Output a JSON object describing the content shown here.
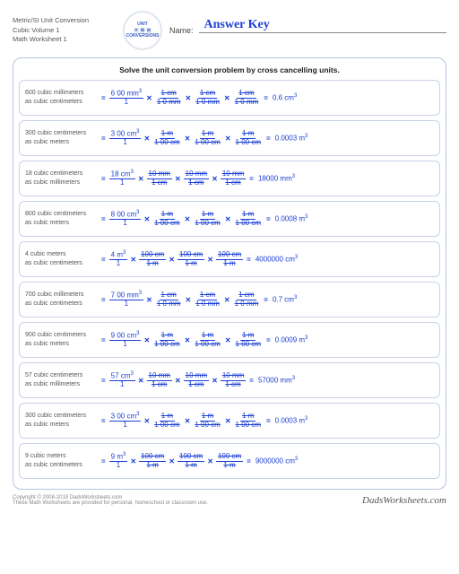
{
  "header": {
    "line1": "Metric/SI Unit Conversion",
    "line2": "Cubic Volume 1",
    "line3": "Math Worksheet 1",
    "logo_top": "UNIT",
    "logo_bot": "CONVERSIONS",
    "name_label": "Name:",
    "answer": "Answer Key"
  },
  "instruction": "Solve the unit conversion problem by cross cancelling units.",
  "rows": [
    {
      "q1": "600 cubic millimeters",
      "q2": "as cubic centimeters",
      "n0": "6 00 mm",
      "d0": "1",
      "nf": "1 cm",
      "df": "1 0 mm",
      "r": "0.6 cm",
      "e": "3"
    },
    {
      "q1": "300 cubic centimeters",
      "q2": "as cubic meters",
      "n0": "3 00 cm",
      "d0": "1",
      "nf": "1 m",
      "df": "1 00 cm",
      "r": "0.0003 m",
      "e": "3"
    },
    {
      "q1": "18 cubic centimeters",
      "q2": "as cubic millimeters",
      "n0": "18 cm",
      "d0": "1",
      "nf": "10 mm",
      "df": "1 cm",
      "r": "18000 mm",
      "e": "3"
    },
    {
      "q1": "800 cubic centimeters",
      "q2": "as cubic meters",
      "n0": "8 00 cm",
      "d0": "1",
      "nf": "1 m",
      "df": "1 00 cm",
      "r": "0.0008 m",
      "e": "3"
    },
    {
      "q1": "4 cubic meters",
      "q2": "as cubic centimeters",
      "n0": "4 m",
      "d0": "1",
      "nf": "100 cm",
      "df": "1 m",
      "r": "4000000 cm",
      "e": "3"
    },
    {
      "q1": "700 cubic millimeters",
      "q2": "as cubic centimeters",
      "n0": "7 00 mm",
      "d0": "1",
      "nf": "1 cm",
      "df": "1 0 mm",
      "r": "0.7 cm",
      "e": "3"
    },
    {
      "q1": "900 cubic centimeters",
      "q2": "as cubic meters",
      "n0": "9 00 cm",
      "d0": "1",
      "nf": "1 m",
      "df": "1 00 cm",
      "r": "0.0009 m",
      "e": "3"
    },
    {
      "q1": "57 cubic centimeters",
      "q2": "as cubic millimeters",
      "n0": "57 cm",
      "d0": "1",
      "nf": "10 mm",
      "df": "1 cm",
      "r": "57000 mm",
      "e": "3"
    },
    {
      "q1": "300 cubic centimeters",
      "q2": "as cubic meters",
      "n0": "3 00 cm",
      "d0": "1",
      "nf": "1 m",
      "df": "1 00 cm",
      "r": "0.0003 m",
      "e": "3"
    },
    {
      "q1": "9 cubic meters",
      "q2": "as cubic centimeters",
      "n0": "9 m",
      "d0": "1",
      "nf": "100 cm",
      "df": "1 m",
      "r": "9000000 cm",
      "e": "3"
    }
  ],
  "footer": {
    "copy": "Copyright © 2008-2019 DadsWorksheets.com",
    "note": "These Math Worksheets are provided for personal, homeschool or classroom use.",
    "brand": "DadsWorksheets.com"
  }
}
